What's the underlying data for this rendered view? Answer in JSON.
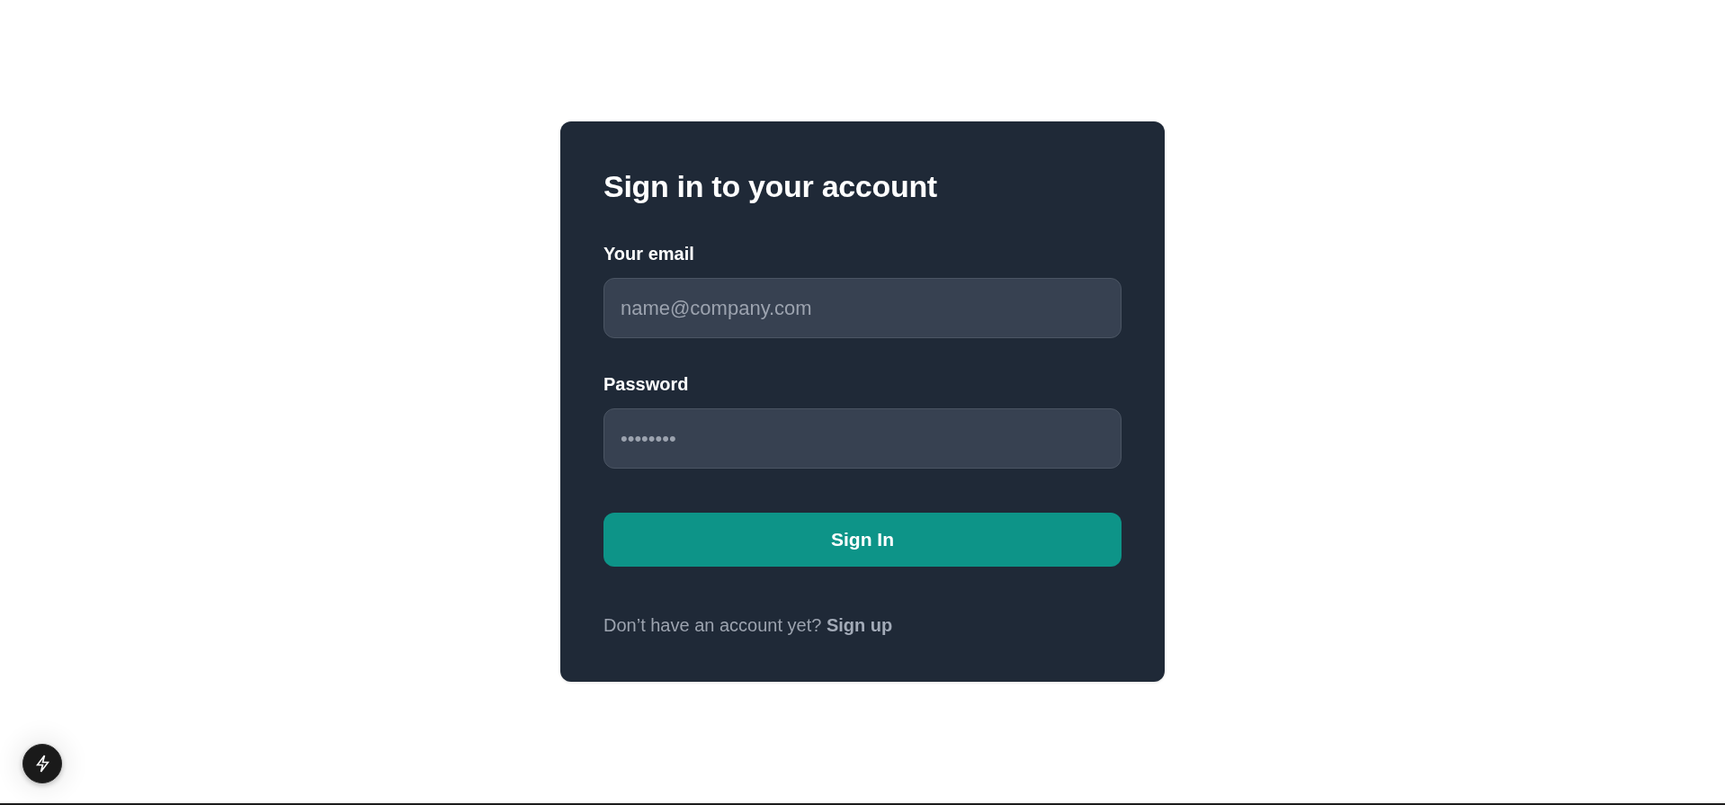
{
  "form": {
    "title": "Sign in to your account",
    "fields": [
      {
        "label": "Your email",
        "placeholder": "name@company.com"
      },
      {
        "label": "Password",
        "placeholder": "••••••••"
      }
    ],
    "submit": "Sign In",
    "footer": {
      "text": "Don’t have an account yet?",
      "link": "Sign up"
    }
  }
}
